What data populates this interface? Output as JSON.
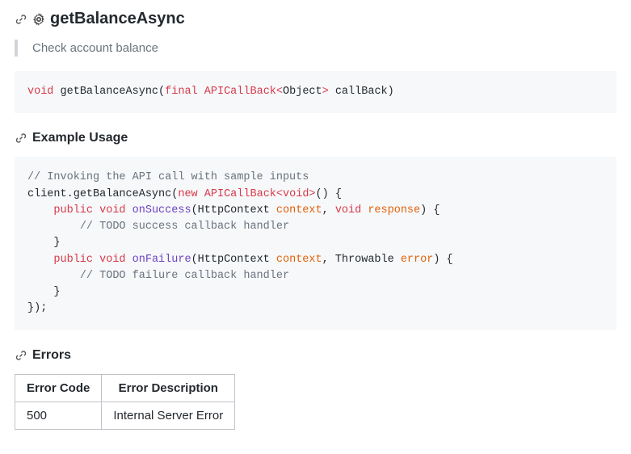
{
  "method": {
    "name": "getBalanceAsync",
    "description": "Check account balance"
  },
  "signature": {
    "ret_kw": "void",
    "space1": " ",
    "fn": "getBalanceAsync",
    "paren_open": "(",
    "final_kw": "final",
    "space2": " ",
    "callback_type": "APICallBack",
    "lt": "<",
    "obj": "Object",
    "gt": ">",
    "rest": " callBack)"
  },
  "example": {
    "heading": "Example Usage",
    "c1": "// Invoking the API call with sample inputs",
    "l2a": "client",
    "l2dot": ".",
    "l2fn": "getBalanceAsync",
    "l2p": "(",
    "l2new": "new",
    "l2sp": " ",
    "l2cb": "APICallBack",
    "l2lt": "<",
    "l2void": "void",
    "l2gt": ">",
    "l2end": "() {",
    "l3pad": "    ",
    "l3pub": "public",
    "l3sp1": " ",
    "l3void": "void",
    "l3sp2": " ",
    "l3fn": "onSuccess",
    "l3p": "(HttpContext ",
    "l3ctx": "context",
    "l3c": ", ",
    "l3v2": "void",
    "l3sp3": " ",
    "l3resp": "response",
    "l3end": ") {",
    "l4pad": "        ",
    "l4c": "// TODO success callback handler",
    "l5": "    }",
    "l6pad": "    ",
    "l6pub": "public",
    "l6sp1": " ",
    "l6void": "void",
    "l6sp2": " ",
    "l6fn": "onFailure",
    "l6p": "(HttpContext ",
    "l6ctx": "context",
    "l6c": ", Throwable ",
    "l6err": "error",
    "l6end": ") {",
    "l7pad": "        ",
    "l7c": "// TODO failure callback handler",
    "l8": "    }",
    "l9": "});"
  },
  "errors": {
    "heading": "Errors",
    "col1": "Error Code",
    "col2": "Error Description",
    "rows": [
      {
        "code": "500",
        "desc": "Internal Server Error"
      }
    ]
  }
}
